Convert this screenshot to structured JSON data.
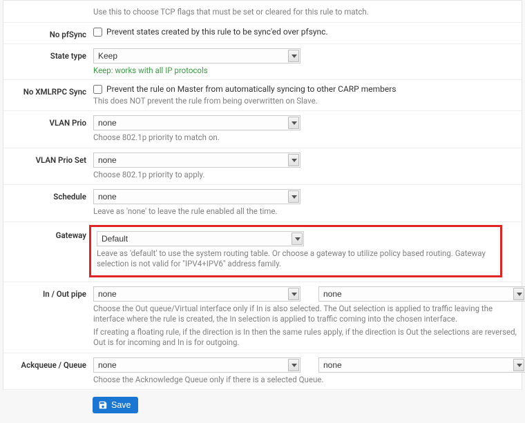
{
  "tcp_flags_help": "Use this to choose TCP flags that must be set or cleared for this rule to match.",
  "no_pfsync": {
    "label": "No pfSync",
    "checkbox_text": "Prevent states created by this rule to be sync'ed over pfsync."
  },
  "state_type": {
    "label": "State type",
    "value": "Keep",
    "help": "Keep: works with all IP protocols"
  },
  "no_xmlrpc": {
    "label": "No XMLRPC Sync",
    "checkbox_text": "Prevent the rule on Master from automatically syncing to other CARP members",
    "help": "This does NOT prevent the rule from being overwritten on Slave."
  },
  "vlan_prio": {
    "label": "VLAN Prio",
    "value": "none",
    "help": "Choose 802.1p priority to match on."
  },
  "vlan_prio_set": {
    "label": "VLAN Prio Set",
    "value": "none",
    "help": "Choose 802.1p priority to apply."
  },
  "schedule": {
    "label": "Schedule",
    "value": "none",
    "help": "Leave as 'none' to leave the rule enabled all the time."
  },
  "gateway": {
    "label": "Gateway",
    "value": "Default",
    "help": "Leave as 'default' to use the system routing table. Or choose a gateway to utilize policy based routing. Gateway selection is not valid for \"IPV4+IPV6\" address family."
  },
  "in_out_pipe": {
    "label": "In / Out pipe",
    "in_value": "none",
    "out_value": "none",
    "help_l1": "Choose the Out queue/Virtual interface only if In is also selected. The Out selection is applied to traffic leaving the interface where the rule is created, the In selection is applied to traffic coming into the chosen interface.",
    "help_l2": "If creating a floating rule, if the direction is In then the same rules apply, if the direction is Out the selections are reversed, Out is for incoming and In is for outgoing."
  },
  "ackqueue": {
    "label": "Ackqueue / Queue",
    "a_value": "none",
    "b_value": "none",
    "help": "Choose the Acknowledge Queue only if there is a selected Queue."
  },
  "save_label": "Save"
}
